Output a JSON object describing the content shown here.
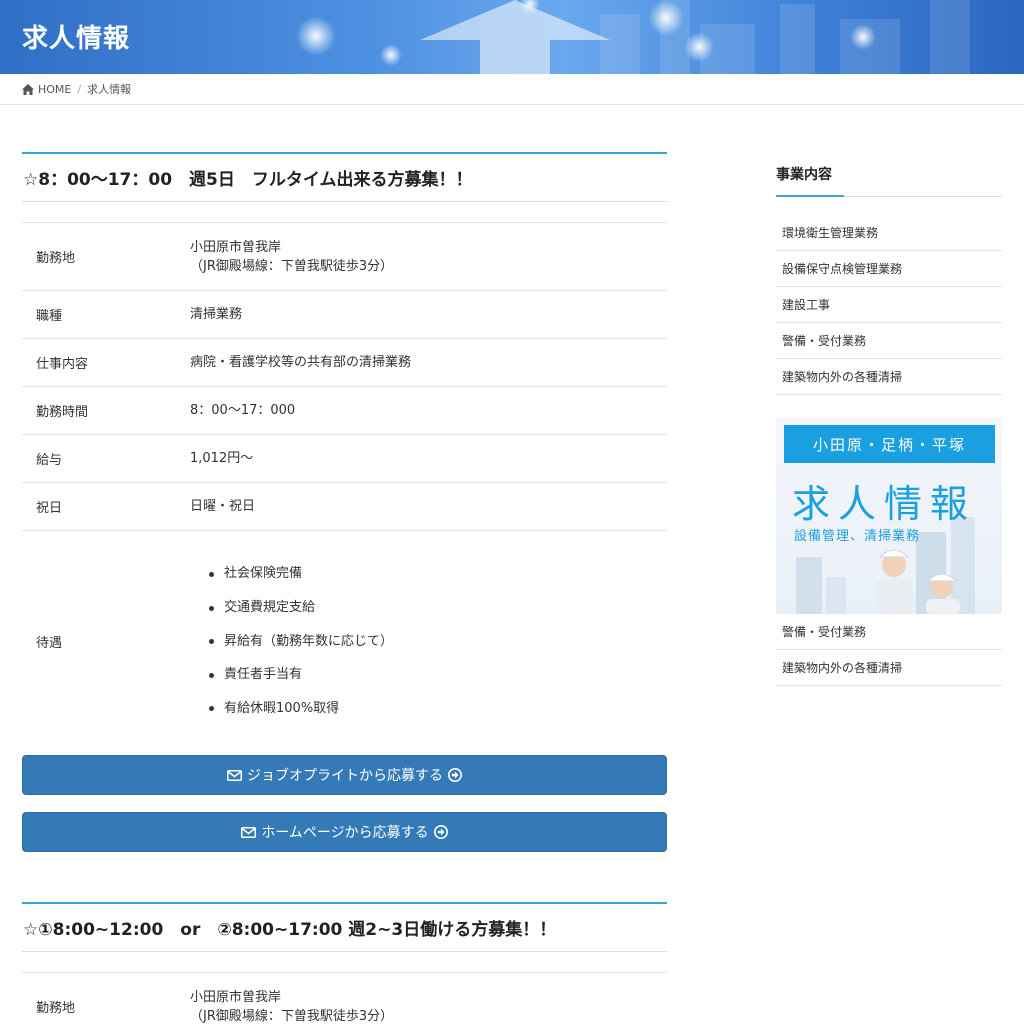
{
  "header": {
    "title": "求人情報"
  },
  "breadcrumb": {
    "home": "HOME",
    "separator": "/",
    "current": "求人情報"
  },
  "jobs": [
    {
      "title": "☆8：00〜17：00　週5日　フルタイム出来る方募集！！",
      "rows": {
        "location_label": "勤務地",
        "location_line1": "小田原市曽我岸",
        "location_line2": "（JR御殿場線：下曽我駅徒歩3分）",
        "type_label": "職種",
        "type_value": "清掃業務",
        "content_label": "仕事内容",
        "content_value": "病院・看護学校等の共有部の清掃業務",
        "hours_label": "勤務時間",
        "hours_value": "8：00〜17：000",
        "pay_label": "給与",
        "pay_value": "1,012円〜",
        "holiday_label": "祝日",
        "holiday_value": "日曜・祝日",
        "benefits_label": "待遇",
        "benefits": [
          "社会保険完備",
          "交通費規定支給",
          "昇給有（勤務年数に応じて）",
          "責任者手当有",
          "有給休暇100%取得"
        ]
      },
      "buttons": {
        "jobofferlite": "ジョブオプライトから応募する",
        "homepage": "ホームページから応募する"
      }
    },
    {
      "title": "☆①8:00~12:00　or　②8:00~17:00 週2~3日働ける方募集！！",
      "rows": {
        "location_label": "勤務地",
        "location_line1": "小田原市曽我岸",
        "location_line2": "（JR御殿場線：下曽我駅徒歩3分）"
      }
    }
  ],
  "sidebar": {
    "heading": "事業内容",
    "items": [
      "環境衛生管理業務",
      "設備保守点検管理業務",
      "建設工事",
      "警備・受付業務",
      "建築物内外の各種清掃"
    ],
    "promo": {
      "region": "小田原・足柄・平塚",
      "title": "求人情報",
      "subtitle": "設備管理、清掃業務"
    },
    "items_after": [
      "警備・受付業務",
      "建築物内外の各種清掃"
    ]
  },
  "colors": {
    "accent": "#3ba3dc",
    "button": "#337ab7",
    "promo": "#1aa0e0"
  },
  "icons": [
    "home-icon",
    "envelope-icon",
    "arrow-circle-right-icon"
  ]
}
